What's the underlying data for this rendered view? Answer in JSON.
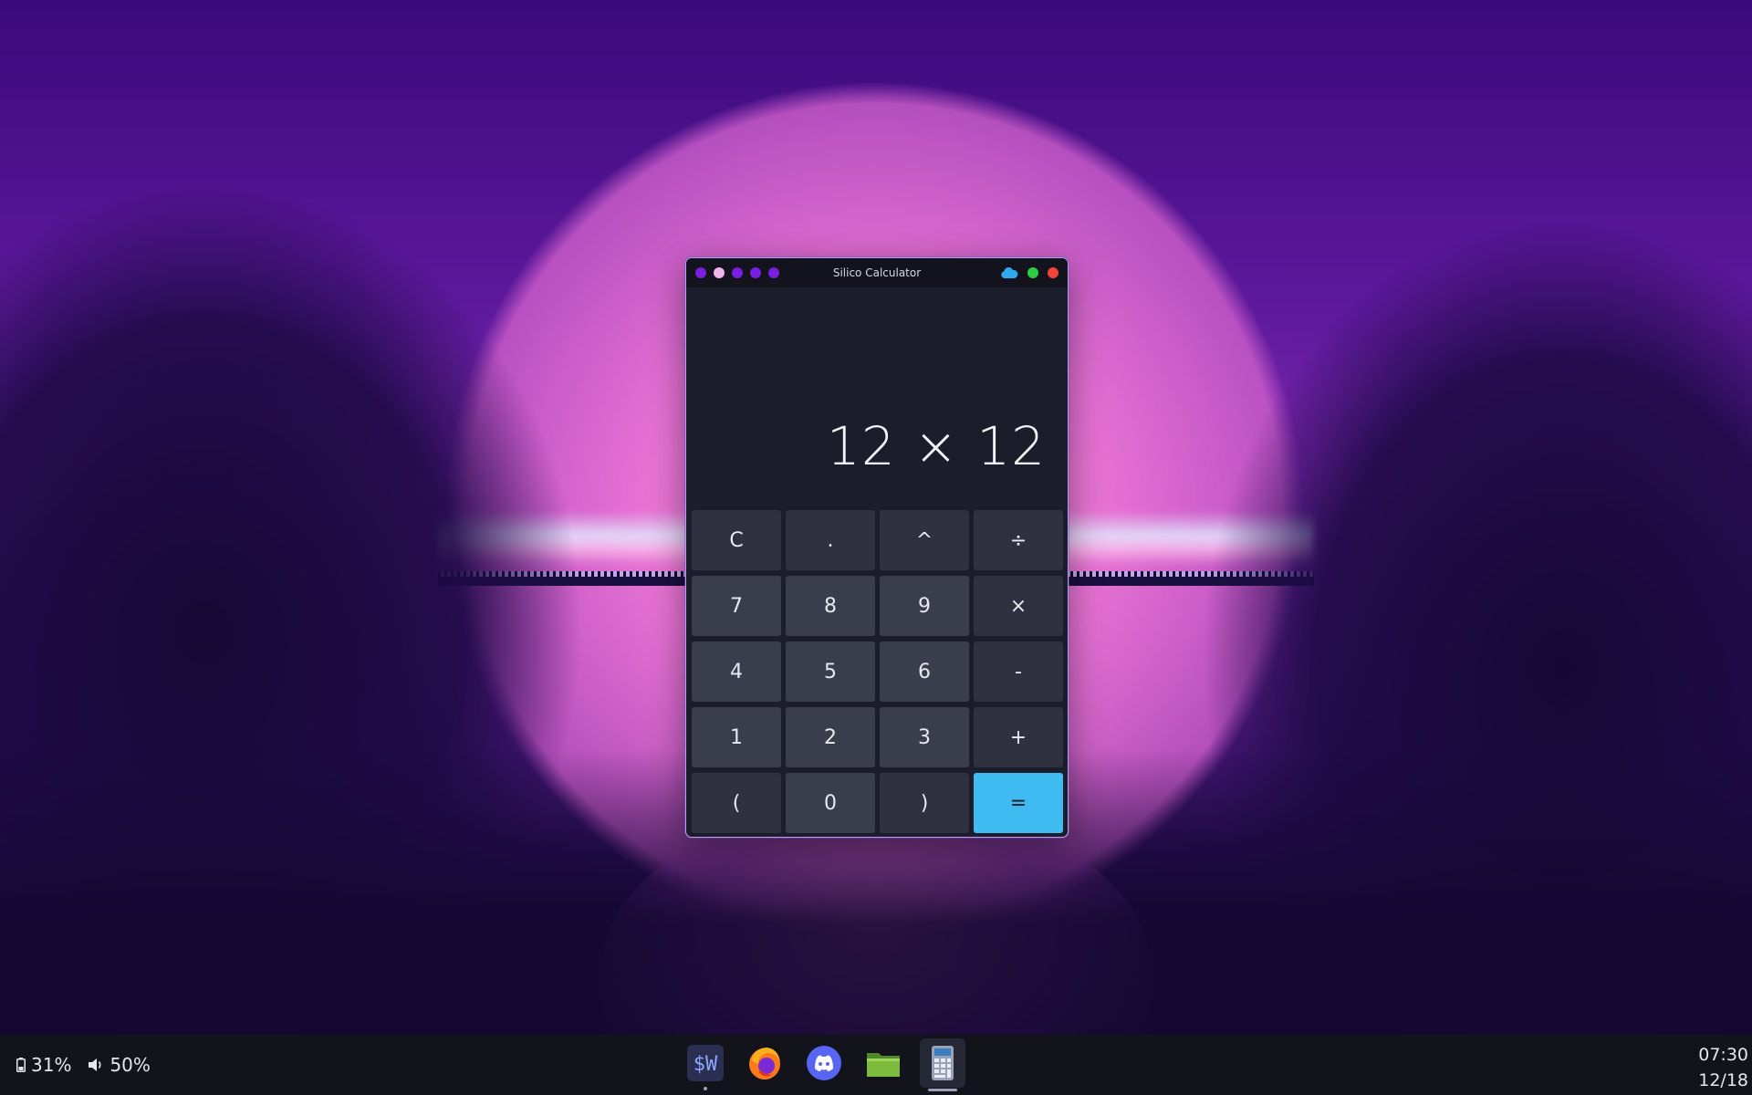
{
  "window": {
    "title": "Silico Calculator",
    "left_dots": [
      "#7a1ee0",
      "#f0b4ec",
      "#7a1ee0",
      "#7a1ee0",
      "#7a1ee0"
    ],
    "controls": {
      "cloud_color": "#2fa8f0",
      "maximize_color": "#2ecc40",
      "close_color": "#f0453a"
    }
  },
  "display": {
    "expression": "12 × 12"
  },
  "keypad": {
    "keys": [
      {
        "label": "C",
        "kind": "op"
      },
      {
        "label": ".",
        "kind": "op"
      },
      {
        "label": "^",
        "kind": "op"
      },
      {
        "label": "÷",
        "kind": "op"
      },
      {
        "label": "7",
        "kind": "num"
      },
      {
        "label": "8",
        "kind": "num"
      },
      {
        "label": "9",
        "kind": "num"
      },
      {
        "label": "×",
        "kind": "op"
      },
      {
        "label": "4",
        "kind": "num"
      },
      {
        "label": "5",
        "kind": "num"
      },
      {
        "label": "6",
        "kind": "num"
      },
      {
        "label": "-",
        "kind": "op"
      },
      {
        "label": "1",
        "kind": "num"
      },
      {
        "label": "2",
        "kind": "num"
      },
      {
        "label": "3",
        "kind": "num"
      },
      {
        "label": "+",
        "kind": "op"
      },
      {
        "label": "(",
        "kind": "op"
      },
      {
        "label": "0",
        "kind": "num"
      },
      {
        "label": ")",
        "kind": "op"
      },
      {
        "label": "=",
        "kind": "equals"
      }
    ],
    "equals_color": "#3ebbf0"
  },
  "taskbar": {
    "battery": "31%",
    "volume": "50%",
    "dock": [
      {
        "name": "terminal",
        "label": "$W",
        "icon": "terminal-icon"
      },
      {
        "name": "firefox",
        "icon": "firefox-icon"
      },
      {
        "name": "discord",
        "icon": "discord-icon"
      },
      {
        "name": "files",
        "icon": "folder-icon"
      },
      {
        "name": "calculator",
        "icon": "calculator-icon"
      }
    ],
    "time": "07:30",
    "date": "12/18"
  }
}
